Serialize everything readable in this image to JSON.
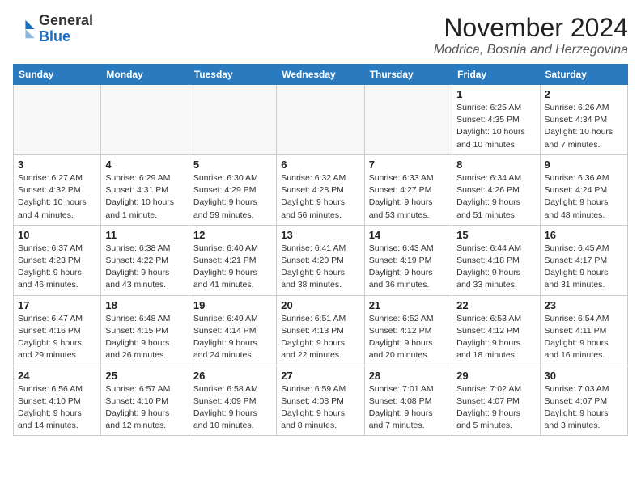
{
  "header": {
    "logo_general": "General",
    "logo_blue": "Blue",
    "month": "November 2024",
    "location": "Modrica, Bosnia and Herzegovina"
  },
  "days_of_week": [
    "Sunday",
    "Monday",
    "Tuesday",
    "Wednesday",
    "Thursday",
    "Friday",
    "Saturday"
  ],
  "weeks": [
    [
      {
        "day": "",
        "info": ""
      },
      {
        "day": "",
        "info": ""
      },
      {
        "day": "",
        "info": ""
      },
      {
        "day": "",
        "info": ""
      },
      {
        "day": "",
        "info": ""
      },
      {
        "day": "1",
        "info": "Sunrise: 6:25 AM\nSunset: 4:35 PM\nDaylight: 10 hours\nand 10 minutes."
      },
      {
        "day": "2",
        "info": "Sunrise: 6:26 AM\nSunset: 4:34 PM\nDaylight: 10 hours\nand 7 minutes."
      }
    ],
    [
      {
        "day": "3",
        "info": "Sunrise: 6:27 AM\nSunset: 4:32 PM\nDaylight: 10 hours\nand 4 minutes."
      },
      {
        "day": "4",
        "info": "Sunrise: 6:29 AM\nSunset: 4:31 PM\nDaylight: 10 hours\nand 1 minute."
      },
      {
        "day": "5",
        "info": "Sunrise: 6:30 AM\nSunset: 4:29 PM\nDaylight: 9 hours\nand 59 minutes."
      },
      {
        "day": "6",
        "info": "Sunrise: 6:32 AM\nSunset: 4:28 PM\nDaylight: 9 hours\nand 56 minutes."
      },
      {
        "day": "7",
        "info": "Sunrise: 6:33 AM\nSunset: 4:27 PM\nDaylight: 9 hours\nand 53 minutes."
      },
      {
        "day": "8",
        "info": "Sunrise: 6:34 AM\nSunset: 4:26 PM\nDaylight: 9 hours\nand 51 minutes."
      },
      {
        "day": "9",
        "info": "Sunrise: 6:36 AM\nSunset: 4:24 PM\nDaylight: 9 hours\nand 48 minutes."
      }
    ],
    [
      {
        "day": "10",
        "info": "Sunrise: 6:37 AM\nSunset: 4:23 PM\nDaylight: 9 hours\nand 46 minutes."
      },
      {
        "day": "11",
        "info": "Sunrise: 6:38 AM\nSunset: 4:22 PM\nDaylight: 9 hours\nand 43 minutes."
      },
      {
        "day": "12",
        "info": "Sunrise: 6:40 AM\nSunset: 4:21 PM\nDaylight: 9 hours\nand 41 minutes."
      },
      {
        "day": "13",
        "info": "Sunrise: 6:41 AM\nSunset: 4:20 PM\nDaylight: 9 hours\nand 38 minutes."
      },
      {
        "day": "14",
        "info": "Sunrise: 6:43 AM\nSunset: 4:19 PM\nDaylight: 9 hours\nand 36 minutes."
      },
      {
        "day": "15",
        "info": "Sunrise: 6:44 AM\nSunset: 4:18 PM\nDaylight: 9 hours\nand 33 minutes."
      },
      {
        "day": "16",
        "info": "Sunrise: 6:45 AM\nSunset: 4:17 PM\nDaylight: 9 hours\nand 31 minutes."
      }
    ],
    [
      {
        "day": "17",
        "info": "Sunrise: 6:47 AM\nSunset: 4:16 PM\nDaylight: 9 hours\nand 29 minutes."
      },
      {
        "day": "18",
        "info": "Sunrise: 6:48 AM\nSunset: 4:15 PM\nDaylight: 9 hours\nand 26 minutes."
      },
      {
        "day": "19",
        "info": "Sunrise: 6:49 AM\nSunset: 4:14 PM\nDaylight: 9 hours\nand 24 minutes."
      },
      {
        "day": "20",
        "info": "Sunrise: 6:51 AM\nSunset: 4:13 PM\nDaylight: 9 hours\nand 22 minutes."
      },
      {
        "day": "21",
        "info": "Sunrise: 6:52 AM\nSunset: 4:12 PM\nDaylight: 9 hours\nand 20 minutes."
      },
      {
        "day": "22",
        "info": "Sunrise: 6:53 AM\nSunset: 4:12 PM\nDaylight: 9 hours\nand 18 minutes."
      },
      {
        "day": "23",
        "info": "Sunrise: 6:54 AM\nSunset: 4:11 PM\nDaylight: 9 hours\nand 16 minutes."
      }
    ],
    [
      {
        "day": "24",
        "info": "Sunrise: 6:56 AM\nSunset: 4:10 PM\nDaylight: 9 hours\nand 14 minutes."
      },
      {
        "day": "25",
        "info": "Sunrise: 6:57 AM\nSunset: 4:10 PM\nDaylight: 9 hours\nand 12 minutes."
      },
      {
        "day": "26",
        "info": "Sunrise: 6:58 AM\nSunset: 4:09 PM\nDaylight: 9 hours\nand 10 minutes."
      },
      {
        "day": "27",
        "info": "Sunrise: 6:59 AM\nSunset: 4:08 PM\nDaylight: 9 hours\nand 8 minutes."
      },
      {
        "day": "28",
        "info": "Sunrise: 7:01 AM\nSunset: 4:08 PM\nDaylight: 9 hours\nand 7 minutes."
      },
      {
        "day": "29",
        "info": "Sunrise: 7:02 AM\nSunset: 4:07 PM\nDaylight: 9 hours\nand 5 minutes."
      },
      {
        "day": "30",
        "info": "Sunrise: 7:03 AM\nSunset: 4:07 PM\nDaylight: 9 hours\nand 3 minutes."
      }
    ]
  ]
}
